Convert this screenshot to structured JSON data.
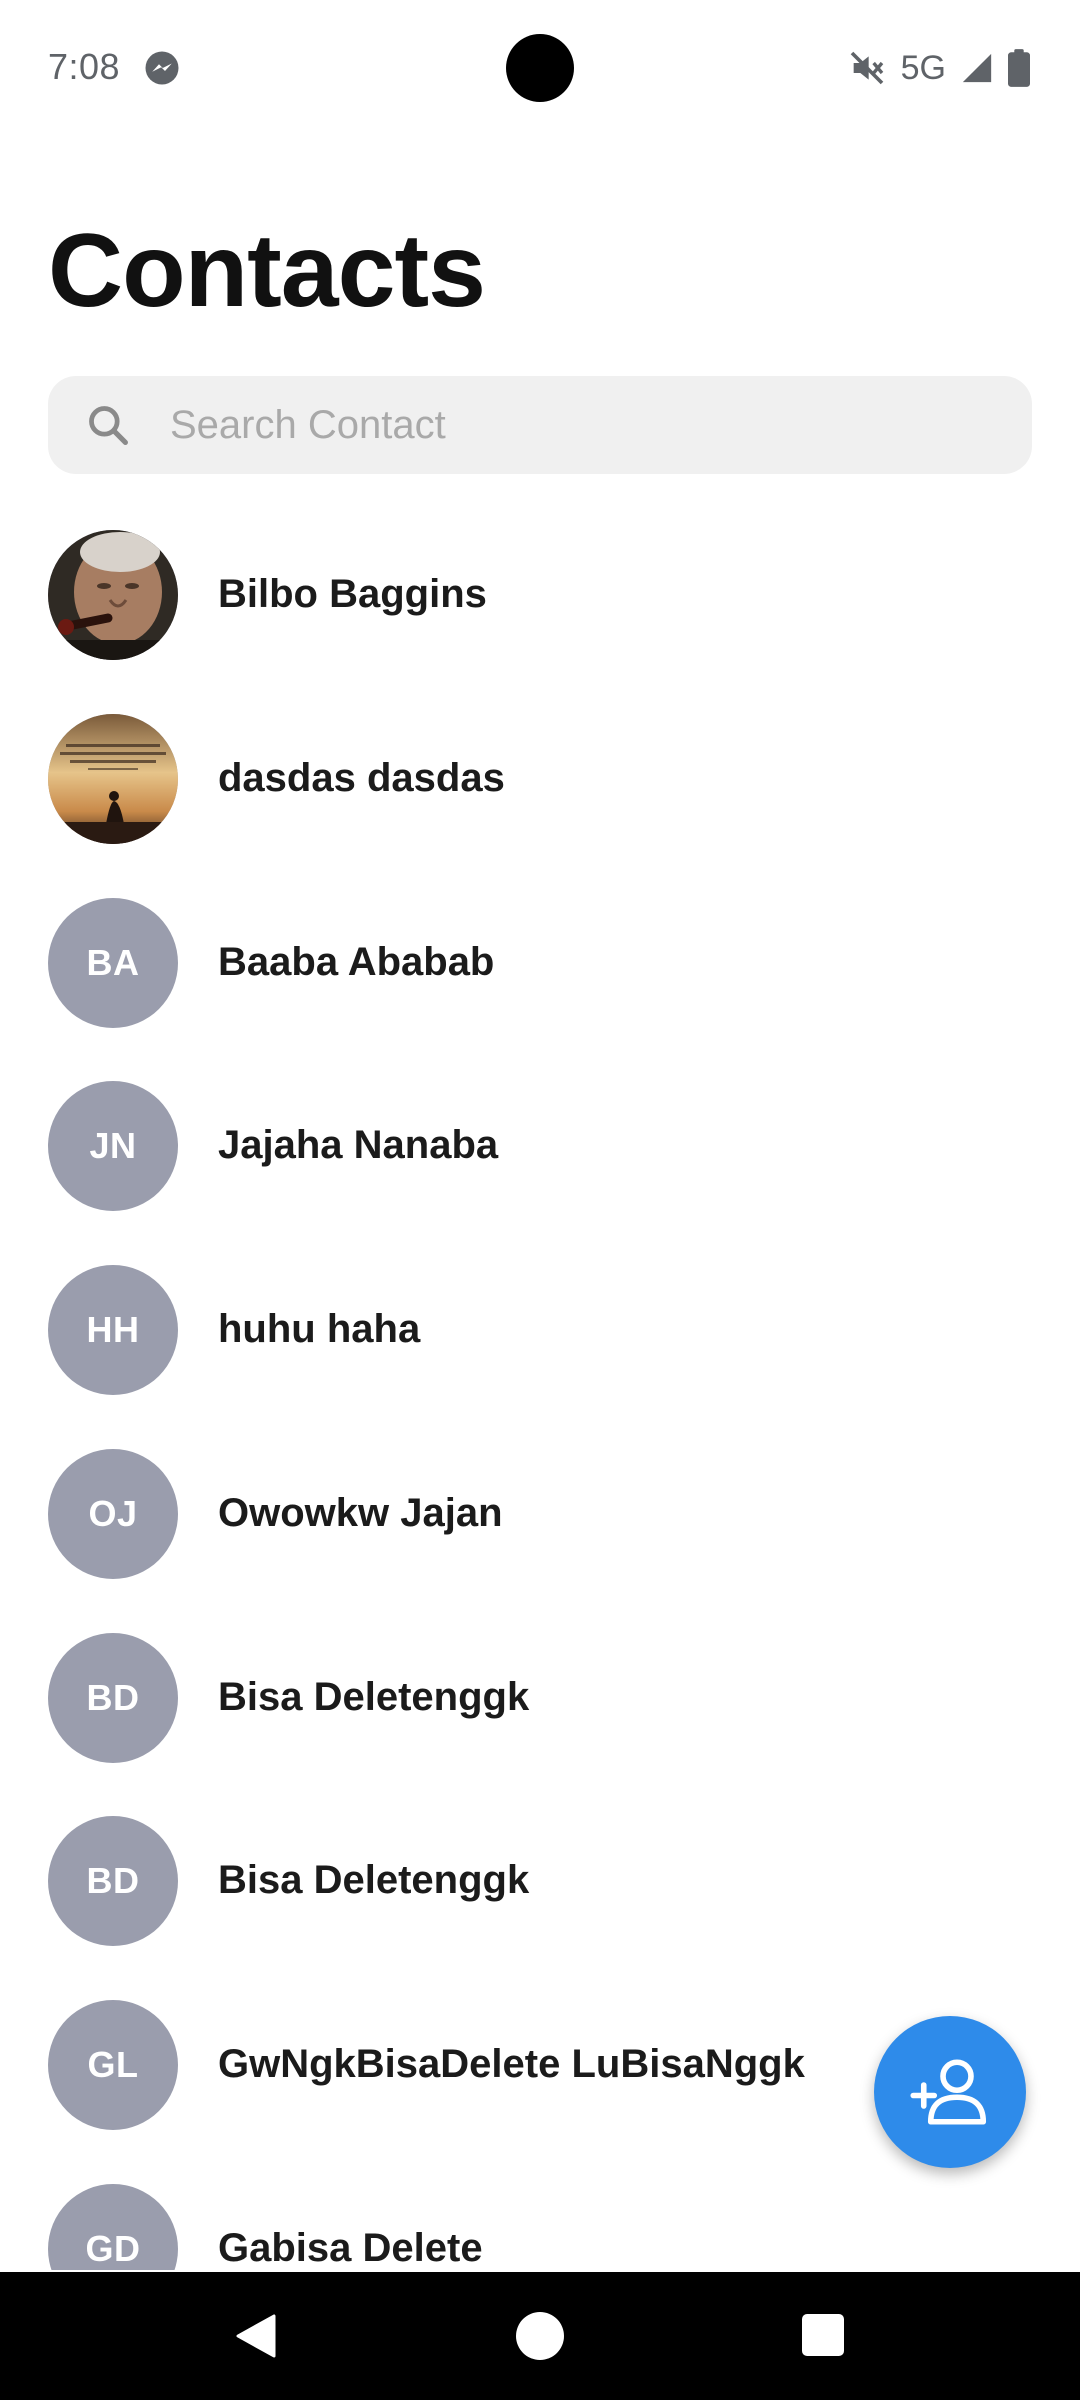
{
  "status_bar": {
    "time": "7:08",
    "network": "5G",
    "icons": [
      "messenger-icon",
      "mute-icon",
      "signal-icon",
      "battery-icon"
    ]
  },
  "page": {
    "title": "Contacts"
  },
  "search": {
    "placeholder": "Search Contact",
    "value": ""
  },
  "contacts": [
    {
      "name": "Bilbo Baggins",
      "initials": "",
      "avatar": "photo-portrait"
    },
    {
      "name": "dasdas dasdas",
      "initials": "",
      "avatar": "photo-sunset-quote"
    },
    {
      "name": "Baaba Ababab",
      "initials": "BA",
      "avatar": "initials"
    },
    {
      "name": "Jajaha Nanaba",
      "initials": "JN",
      "avatar": "initials"
    },
    {
      "name": "huhu haha",
      "initials": "HH",
      "avatar": "initials"
    },
    {
      "name": "Owowkw Jajan",
      "initials": "OJ",
      "avatar": "initials"
    },
    {
      "name": "Bisa Deletenggk",
      "initials": "BD",
      "avatar": "initials"
    },
    {
      "name": "Bisa Deletenggk",
      "initials": "BD",
      "avatar": "initials"
    },
    {
      "name": "GwNgkBisaDelete LuBisaNggk",
      "initials": "GL",
      "avatar": "initials"
    },
    {
      "name": "Gabisa Delete",
      "initials": "GD",
      "avatar": "initials"
    }
  ],
  "fab": {
    "icon": "add-contact-icon"
  },
  "nav_bar": {
    "icons": [
      "back-icon",
      "home-icon",
      "recents-icon"
    ]
  },
  "colors": {
    "accent": "#2e8bea",
    "avatar_bg": "#9a9dad",
    "search_bg": "#f0f0f0",
    "title": "#111111"
  }
}
